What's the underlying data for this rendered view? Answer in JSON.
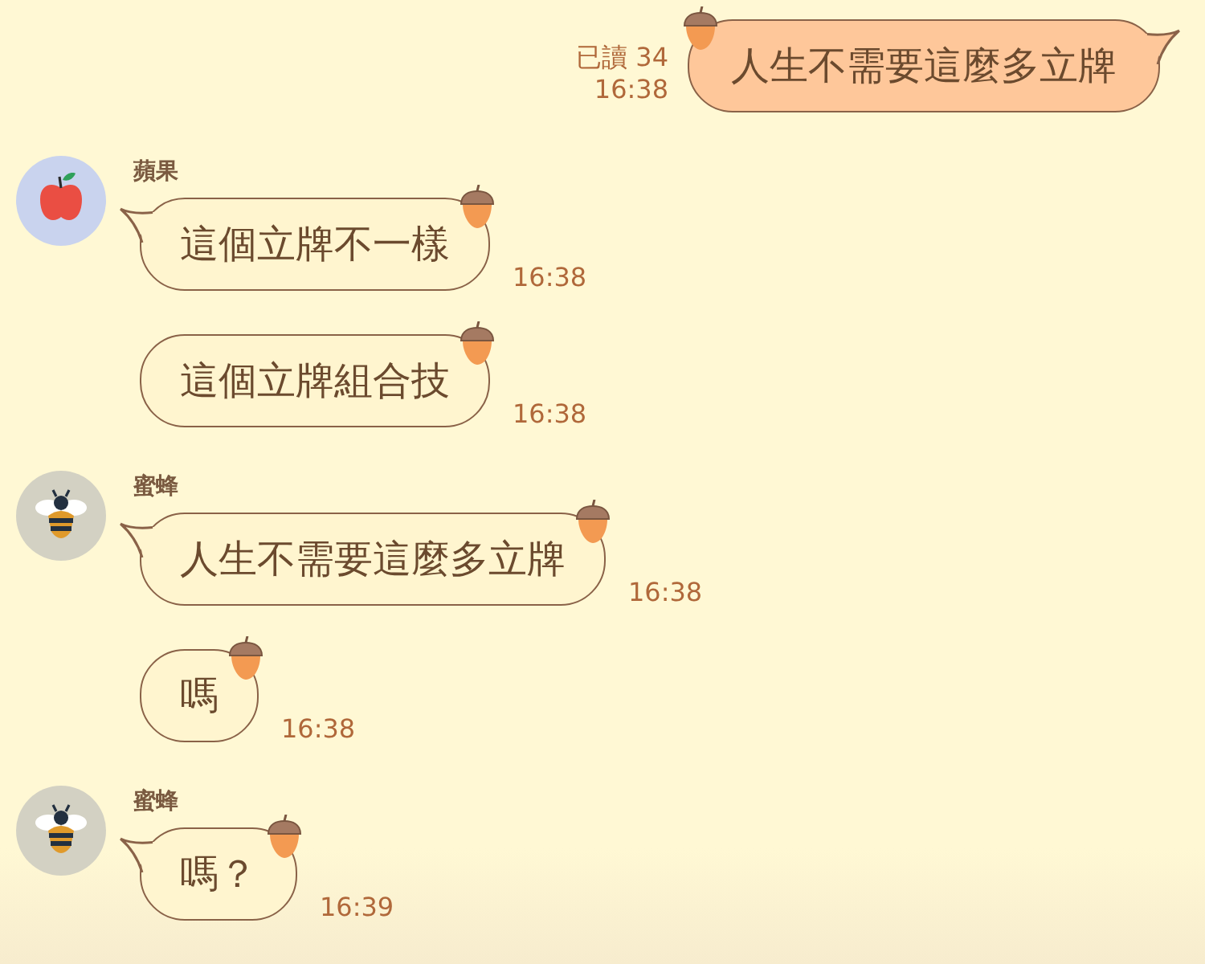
{
  "messages": [
    {
      "kind": "outgoing",
      "text": "人生不需要這麼多立牌",
      "read": "已讀 34",
      "time": "16:38"
    },
    {
      "kind": "incoming",
      "sender": "蘋果",
      "avatar": {
        "kind": "apple"
      },
      "text": "這個立牌不一樣",
      "time": "16:38"
    },
    {
      "kind": "incoming",
      "text": "這個立牌組合技",
      "time": "16:38"
    },
    {
      "kind": "incoming",
      "sender": "蜜蜂",
      "avatar": {
        "kind": "bee"
      },
      "text": "人生不需要這麼多立牌",
      "time": "16:38"
    },
    {
      "kind": "incoming",
      "text": "嗎",
      "time": "16:38"
    },
    {
      "kind": "incoming",
      "sender": "蜜蜂",
      "avatar": {
        "kind": "bee"
      },
      "text": "嗎？",
      "time": "16:39"
    }
  ]
}
